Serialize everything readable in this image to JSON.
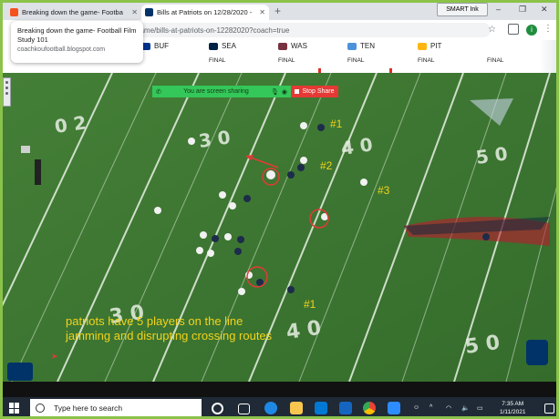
{
  "browser": {
    "tabs": [
      {
        "title": "Breaking down the game- Footba",
        "favicon_color": "#f4511e",
        "active": false
      },
      {
        "title": "Bills at Patriots on 12/28/2020 -",
        "favicon_color": "#013369",
        "favicon_text": "NFL",
        "active": true
      }
    ],
    "smart_ink_label": "SMART Ink",
    "url": "game/bills-at-patriots-on-12282020?coach=true",
    "avatar_letter": "i"
  },
  "tooltip": {
    "title": "Breaking down the game- Football Film Study 101",
    "domain": "coachkoufootball.blogspot.com"
  },
  "scoreboard": [
    {
      "team": "BUF",
      "result": "",
      "logo_color": "#00338d"
    },
    {
      "team": "SEA",
      "result": "FINAL",
      "logo_color": "#002244"
    },
    {
      "team": "WAS",
      "result": "FINAL",
      "logo_color": "#773141"
    },
    {
      "team": "TEN",
      "result": "FINAL",
      "logo_color": "#4b92db"
    },
    {
      "team": "PIT",
      "result": "FINAL",
      "logo_color": "#ffb612"
    },
    {
      "team": "",
      "result": "FINAL",
      "logo_color": "#ffffff"
    }
  ],
  "screen_share": {
    "message": "You are screen sharing",
    "stop_label": "Stop Share"
  },
  "field_numbers": [
    "0 2",
    "3 0",
    "4 0",
    "5 0",
    "3 0",
    "4 0",
    "5 0"
  ],
  "annotations": {
    "labels": [
      "#1",
      "#2",
      "#3",
      "#1"
    ],
    "caption": "patriots have 5 players on the line jamming and disrupting crossing routes",
    "colors": {
      "label": "#f2d31b",
      "circle": "#e53935"
    }
  },
  "taskbar": {
    "search_placeholder": "Type here to search",
    "time": "7:35 AM",
    "date": "1/11/2021"
  }
}
